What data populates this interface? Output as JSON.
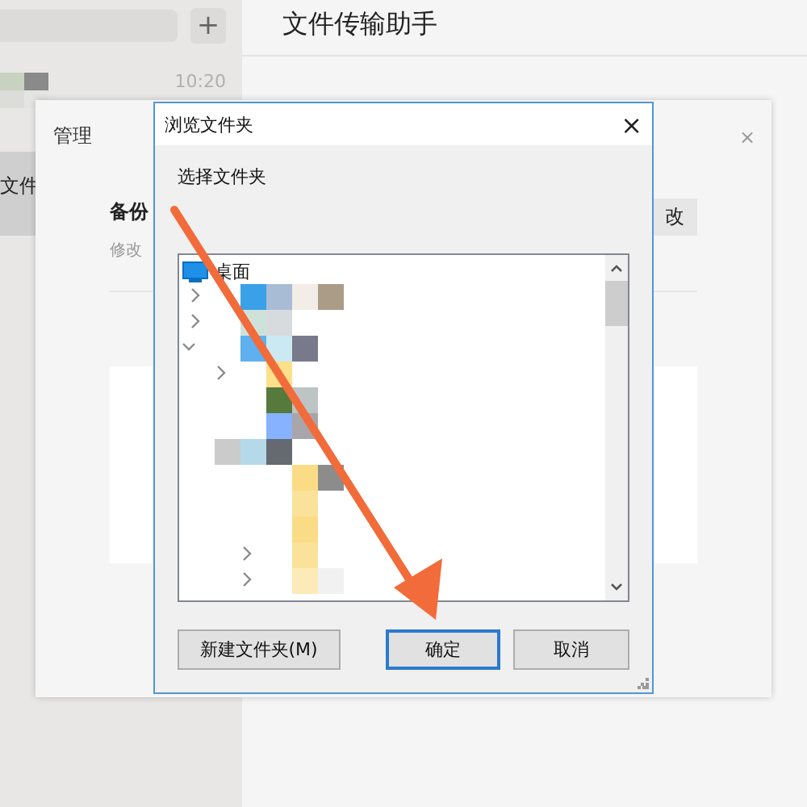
{
  "chat_panel": {
    "add_button": "+",
    "chats": [
      {
        "time": "10:20",
        "selected": false
      },
      {
        "name": "文件",
        "selected": true
      }
    ]
  },
  "chat_title": "文件传输助手",
  "manage_dialog": {
    "title": "管理",
    "close": "×",
    "setting_label": "备份",
    "setting_hint": "修改",
    "change_button": "改"
  },
  "browse_dialog": {
    "title": "浏览文件夹",
    "close": "×",
    "prompt": "选择文件夹",
    "tree": [
      {
        "label": "桌面"
      }
    ],
    "buttons": [
      {
        "label": "新建文件夹(M)",
        "default": false
      },
      {
        "label": "确定",
        "default": true
      },
      {
        "label": "取消",
        "default": false
      }
    ]
  },
  "annotation": {
    "kind": "arrow"
  }
}
